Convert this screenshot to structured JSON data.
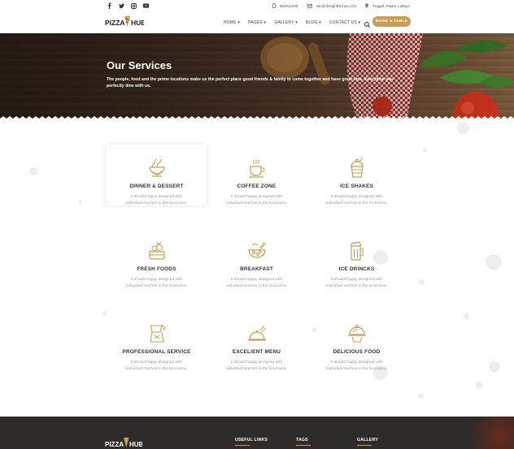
{
  "topbar": {
    "social": [
      "facebook-icon",
      "twitter-icon",
      "instagram-icon",
      "youtube-icon"
    ],
    "phone": "56491234b",
    "email": "info@designthemes.com",
    "location": "Tuggal, Palais, Lalitpur"
  },
  "header": {
    "nav": [
      "HOME ▾",
      "PAGES ▾",
      "GALLERY ▾",
      "BLOG ▾",
      "CONTACT US ▾"
    ],
    "book_label": "BOOK A TABLE",
    "brand_color": "#c89d54"
  },
  "hero": {
    "title": "Our Services",
    "text": "The people, food and the prime locations make us the perfect place good friends & family to come together and have great time. Everytime you perfectly dine with us."
  },
  "services": [
    {
      "title": "DINNER & DESSERT",
      "desc": "It should happy designed with individual touches to the local area.",
      "icon": "dinner-bowl-icon"
    },
    {
      "title": "COFFEE ZONE",
      "desc": "It should happy designed with individual touches to the local area.",
      "icon": "coffee-cup-icon"
    },
    {
      "title": "ICE SHAKES",
      "desc": "It should happy designed with individual touches to the local area.",
      "icon": "ice-shake-icon"
    },
    {
      "title": "FRESH FOODS",
      "desc": "It should happy designed with individual touches to the local area.",
      "icon": "fresh-food-icon"
    },
    {
      "title": "BREAKFAST",
      "desc": "It should happy designed with individual touches to the local area.",
      "icon": "breakfast-bowl-icon"
    },
    {
      "title": "ICE DRINCKS",
      "desc": "It should happy designed with individual touches to the local area.",
      "icon": "ice-drink-icon"
    },
    {
      "title": "PROFESSIONAL SERVICE",
      "desc": "It should happy designed with individual touches to the local area.",
      "icon": "chef-service-icon"
    },
    {
      "title": "EXCELIENT MENU",
      "desc": "It should happy designed with individual touches to the local area.",
      "icon": "menu-dish-icon"
    },
    {
      "title": "DELICIOUS FOOD",
      "desc": "It should happy designed with individual touches to the local area.",
      "icon": "cloche-icon"
    }
  ],
  "footer": {
    "headings": [
      "USEFUL LINKS",
      "TAGS",
      "GALLERY"
    ]
  },
  "brand": {
    "line1": "PIZZA",
    "line2": "HUB"
  }
}
